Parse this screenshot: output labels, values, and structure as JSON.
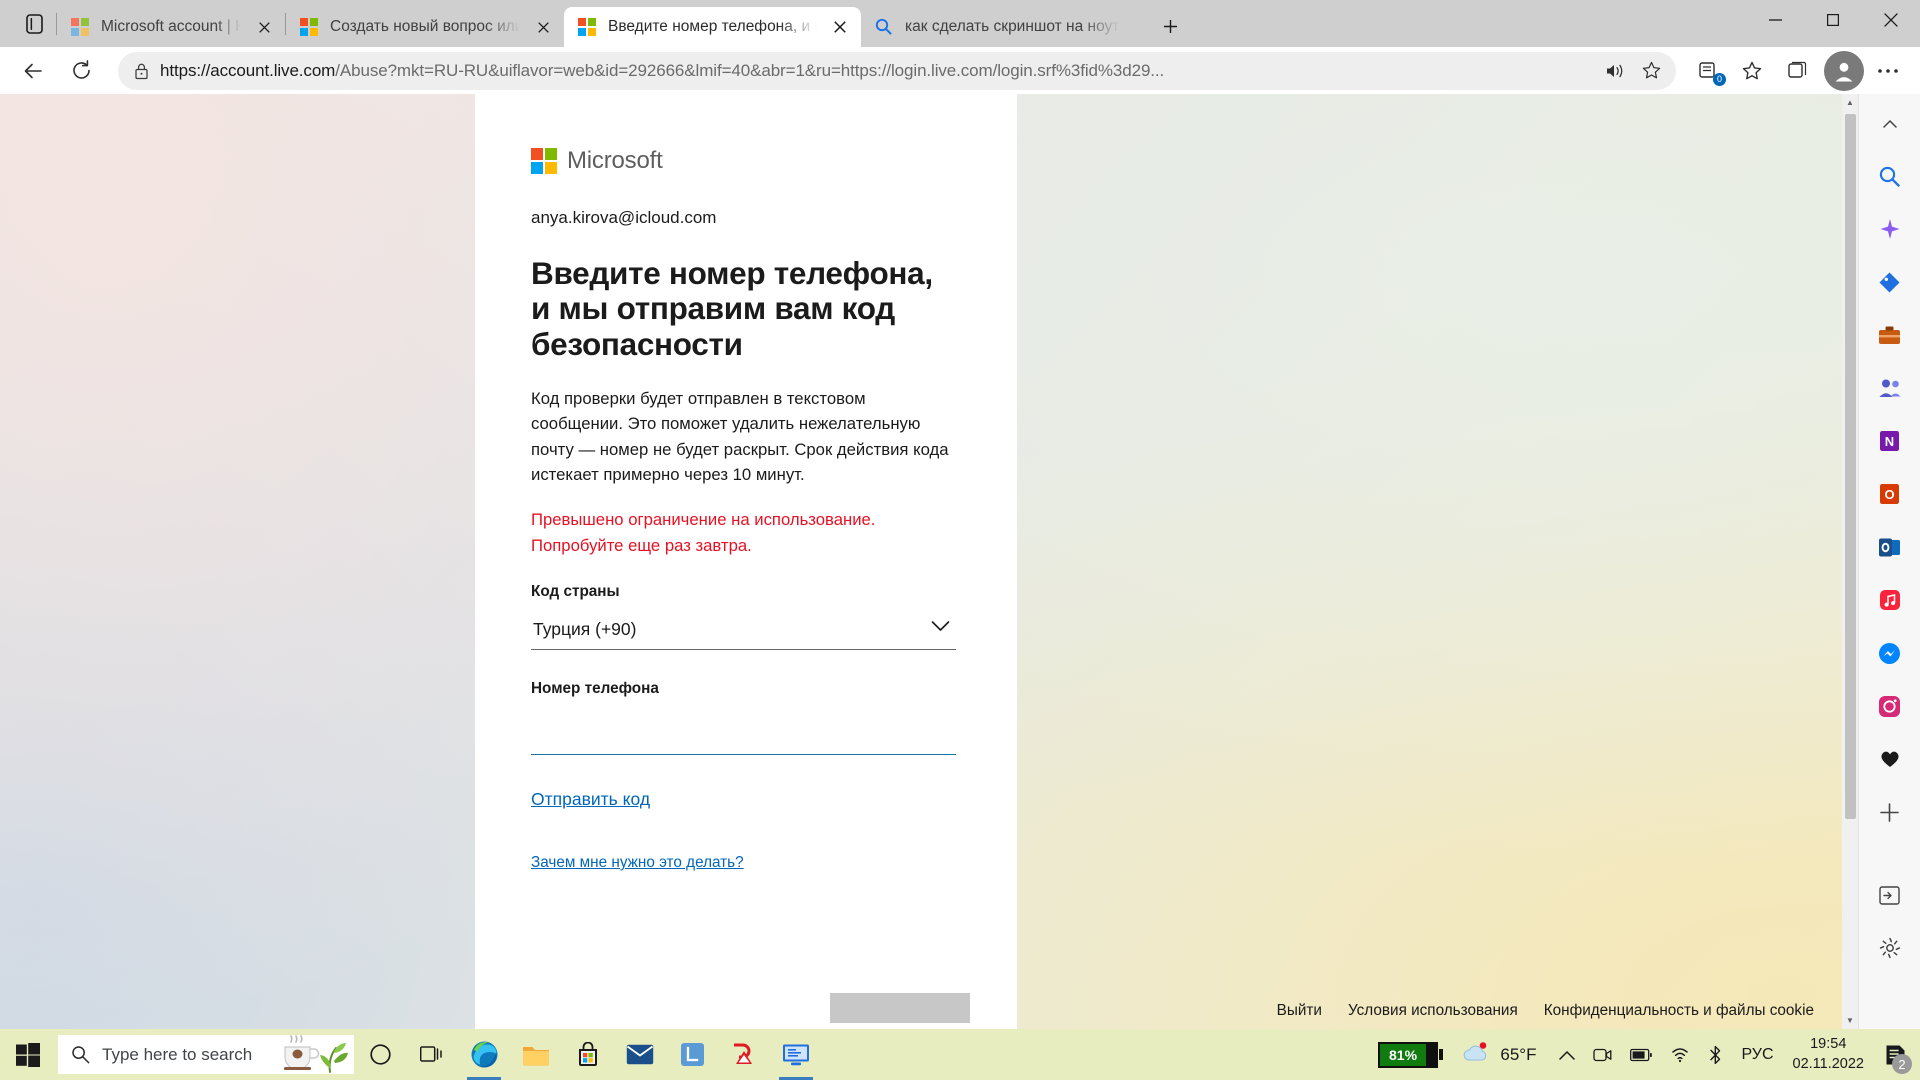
{
  "browser": {
    "tab_actions_icon": "tab-actions-icon",
    "new_tab_label": "+",
    "tabs": [
      {
        "title": "Microsoft account | Home",
        "favicon": "microsoft-logo-icon",
        "active": false
      },
      {
        "title": "Создать новый вопрос или нач",
        "favicon": "microsoft-logo-icon",
        "active": false
      },
      {
        "title": "Введите номер телефона, и мы",
        "favicon": "microsoft-logo-icon",
        "active": true
      },
      {
        "title": "как сделать скриншот на ноутб",
        "favicon": "search-icon",
        "active": false
      }
    ],
    "window_controls": {
      "minimize": "minimize-icon",
      "maximize": "maximize-icon",
      "close": "close-icon"
    },
    "nav": {
      "back": "back-arrow-icon",
      "refresh": "refresh-icon"
    },
    "address": {
      "lock_icon": "lock-icon",
      "url_prefix": "https://account.live.com",
      "url_rest": "/Abuse?mkt=RU-RU&uiflavor=web&id=292666&lmif=40&abr=1&ru=https://login.live.com/login.srf%3fid%3d29...",
      "read_aloud_icon": "read-aloud-icon",
      "collections_badge_icon": "collections-add-icon"
    },
    "toolbar_icons": [
      "favorites-star-icon",
      "collections-icon",
      "profile-avatar",
      "settings-more-icon"
    ]
  },
  "page": {
    "brand": "Microsoft",
    "account_email": "anya.kirova@icloud.com",
    "heading": "Введите номер телефона, и мы отправим вам код безопасности",
    "body": "Код проверки будет отправлен в текстовом сообщении. Это поможет удалить нежелательную почту — номер не будет раскрыт. Срок действия кода истекает примерно через 10 минут.",
    "error": "Превышено ограничение на использование. Попробуйте еще раз завтра.",
    "country_label": "Код страны",
    "country_value": "Турция (+90)",
    "country_options": [
      "Турция (+90)"
    ],
    "phone_label": "Номер телефона",
    "phone_value": "",
    "phone_placeholder": "",
    "submit_link": "Отправить код",
    "why_link": "Зачем мне нужно это делать?",
    "footer_links": [
      "Выйти",
      "Условия использования",
      "Конфиденциальность и файлы cookie"
    ]
  },
  "sidebar": {
    "items": [
      {
        "name": "chevron-up-icon",
        "glyph": "⌃"
      },
      {
        "name": "bing-search-icon",
        "glyph": "🔍"
      },
      {
        "name": "bing-chat-sparkle-icon",
        "glyph": "✦"
      },
      {
        "name": "shopping-deals-icon",
        "glyph": "◆"
      },
      {
        "name": "office-tools-icon",
        "glyph": "🧰"
      },
      {
        "name": "teams-people-icon",
        "glyph": "👥"
      },
      {
        "name": "onenote-icon",
        "glyph": "N"
      },
      {
        "name": "office-icon",
        "glyph": "O"
      },
      {
        "name": "outlook-icon",
        "glyph": "✉"
      },
      {
        "name": "music-icon",
        "glyph": "♫"
      },
      {
        "name": "messenger-icon",
        "glyph": "✆"
      },
      {
        "name": "instagram-icon",
        "glyph": "◎"
      },
      {
        "name": "drop-favorites-icon",
        "glyph": "♥"
      },
      {
        "name": "add-sidebar-app-icon",
        "glyph": "＋"
      },
      {
        "name": "open-sidebar-icon",
        "glyph": "⇥"
      },
      {
        "name": "sidebar-settings-icon",
        "glyph": "⚙"
      }
    ]
  },
  "scrollbar": {
    "up_arrow": "▲",
    "down_arrow": "▼"
  },
  "taskbar": {
    "start_icon": "windows-start-icon",
    "search_placeholder": "Type here to search",
    "search_icon": "search-icon",
    "apps": [
      {
        "name": "cortana-icon",
        "glyph": "◯",
        "active": false
      },
      {
        "name": "task-view-icon",
        "glyph": "❑",
        "active": false
      },
      {
        "name": "microsoft-edge-icon",
        "glyph": "e",
        "active": true
      },
      {
        "name": "file-explorer-icon",
        "glyph": "🗀",
        "active": false
      },
      {
        "name": "microsoft-store-icon",
        "glyph": "🛍",
        "active": false
      },
      {
        "name": "mail-icon",
        "glyph": "✉",
        "active": false
      },
      {
        "name": "lightshot-icon",
        "glyph": "L",
        "active": false
      },
      {
        "name": "bitdefender-icon",
        "glyph": "B",
        "active": false
      },
      {
        "name": "remote-desktop-icon",
        "glyph": "🖥",
        "active": true
      }
    ],
    "battery_percent": "81%",
    "battery_level": 81,
    "weather_icon": "cloud-icon",
    "weather_temp": "65°F",
    "tray_icons": [
      {
        "name": "show-hidden-icons-chevron",
        "glyph": "⌃"
      },
      {
        "name": "meet-now-camera-icon",
        "glyph": "▭"
      },
      {
        "name": "battery-tray-icon",
        "glyph": "▬"
      },
      {
        "name": "wifi-icon",
        "glyph": "⌁"
      },
      {
        "name": "bluetooth-icon",
        "glyph": "✦"
      }
    ],
    "language": "РУС",
    "time": "19:54",
    "date": "02.11.2022",
    "notification_icon": "action-center-icon",
    "notification_count": "2"
  },
  "colors": {
    "accent_blue": "#0067b8",
    "error_red": "#e81123",
    "taskbar_bg": "#e8edbf",
    "battery_green": "#107c10"
  }
}
